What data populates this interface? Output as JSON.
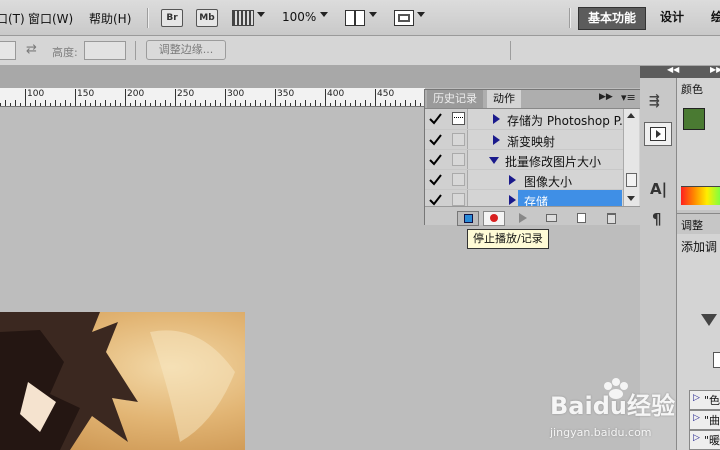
{
  "menubar": {
    "items": [
      "口(T)",
      "窗口(W)",
      "帮助(H)"
    ],
    "icons": [
      "Br",
      "Mb"
    ],
    "zoom": "100%",
    "workspaces": [
      "基本功能",
      "设计",
      "绘"
    ]
  },
  "options": {
    "height_label": "高度:",
    "refine_button": "调整边缘..."
  },
  "ruler": {
    "labels": [
      "100",
      "150",
      "200",
      "250",
      "300",
      "350",
      "400",
      "450"
    ]
  },
  "actions_panel": {
    "tabs": [
      "历史记录",
      "动作"
    ],
    "rows": [
      {
        "label": "存储为 Photoshop P...",
        "indent": 1,
        "expanded": false,
        "selected": false
      },
      {
        "label": "渐变映射",
        "indent": 1,
        "expanded": false,
        "selected": false
      },
      {
        "label": "批量修改图片大小",
        "indent": 0,
        "expanded": true,
        "selected": false
      },
      {
        "label": "图像大小",
        "indent": 2,
        "expanded": false,
        "selected": false
      },
      {
        "label": "存储",
        "indent": 2,
        "expanded": false,
        "selected": true
      }
    ],
    "tooltip": "停止播放/记录"
  },
  "dock": {
    "color_tab": "颜色",
    "adjust_tab": "调整",
    "adjust_text": "添加调",
    "list_items": [
      "\"色",
      "\"曲",
      "\"暖"
    ],
    "tool_glyphs": [
      "A|",
      "¶"
    ],
    "colors": {
      "foreground": "#4a7a32",
      "background": "#f08080"
    }
  },
  "watermark": {
    "brand": "Baidu经验",
    "url": "jingyan.baidu.com"
  }
}
